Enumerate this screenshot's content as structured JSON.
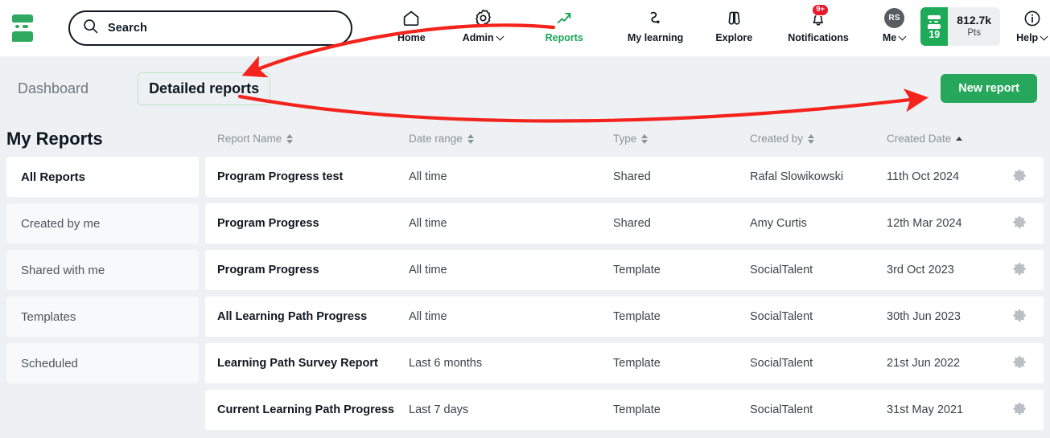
{
  "topnav": {
    "logo_name": "socialtalent-logo",
    "search": {
      "placeholder": "Search",
      "value": "Search",
      "icon": "search-icon"
    },
    "items": [
      {
        "label": "Home",
        "icon": "home-icon",
        "active": false,
        "caret": false
      },
      {
        "label": "Admin",
        "icon": "gear-icon",
        "active": false,
        "caret": true
      },
      {
        "label": "Reports",
        "icon": "trending-up-icon",
        "active": true,
        "caret": false
      },
      {
        "label": "My learning",
        "icon": "learning-path-icon",
        "active": false,
        "caret": false
      },
      {
        "label": "Explore",
        "icon": "binoculars-icon",
        "active": false,
        "caret": false
      },
      {
        "label": "Notifications",
        "icon": "bell-icon",
        "active": false,
        "caret": false,
        "badge": "9+"
      },
      {
        "label": "Me",
        "icon": "avatar-icon",
        "active": false,
        "caret": true,
        "avatar_initials": "RS"
      }
    ],
    "points": {
      "level": "19",
      "value": "812.7k",
      "unit": "Pts"
    },
    "help": {
      "label": "Help",
      "icon": "info-icon",
      "caret": true
    }
  },
  "subheader": {
    "breadcrumb_dashboard": "Dashboard",
    "breadcrumb_current": "Detailed reports",
    "new_report_label": "New report"
  },
  "sidebar": {
    "title": "My Reports",
    "items": [
      {
        "label": "All Reports",
        "active": true
      },
      {
        "label": "Created by me",
        "active": false
      },
      {
        "label": "Shared with me",
        "active": false
      },
      {
        "label": "Templates",
        "active": false
      },
      {
        "label": "Scheduled",
        "active": false
      }
    ]
  },
  "table": {
    "columns": [
      {
        "label": "Report Name",
        "sort": "none"
      },
      {
        "label": "Date range",
        "sort": "none"
      },
      {
        "label": "Type",
        "sort": "none"
      },
      {
        "label": "Created by",
        "sort": "none"
      },
      {
        "label": "Created Date",
        "sort": "asc"
      }
    ],
    "rows": [
      {
        "name": "Program Progress test",
        "range": "All time",
        "type": "Shared",
        "by": "Rafal Slowikowski",
        "created": "11th Oct 2024",
        "action_icon": "gear-icon"
      },
      {
        "name": "Program Progress",
        "range": "All time",
        "type": "Shared",
        "by": "Amy Curtis",
        "created": "12th Mar 2024",
        "action_icon": "gear-icon"
      },
      {
        "name": "Program Progress",
        "range": "All time",
        "type": "Template",
        "by": "SocialTalent",
        "created": "3rd Oct 2023",
        "action_icon": "gear-icon"
      },
      {
        "name": "All Learning Path Progress",
        "range": "All time",
        "type": "Template",
        "by": "SocialTalent",
        "created": "30th Jun 2023",
        "action_icon": "gear-icon"
      },
      {
        "name": "Learning Path Survey Report",
        "range": "Last 6 months",
        "type": "Template",
        "by": "SocialTalent",
        "created": "21st Jun 2022",
        "action_icon": "gear-icon"
      },
      {
        "name": "Current Learning Path Progress",
        "range": "Last 7 days",
        "type": "Template",
        "by": "SocialTalent",
        "created": "31st May 2021",
        "action_icon": "gear-icon"
      }
    ]
  },
  "annotations": {
    "color": "#f4231c",
    "arrow_1": "reports-nav-to-detailed-reports",
    "arrow_2": "detailed-reports-to-new-report"
  },
  "colors": {
    "brand_green": "#27a75b",
    "accent_green": "#18a558",
    "page_bg": "#edf1f4",
    "ink": "#101820",
    "muted": "#8b9399",
    "annotation_red": "#f4231c"
  }
}
